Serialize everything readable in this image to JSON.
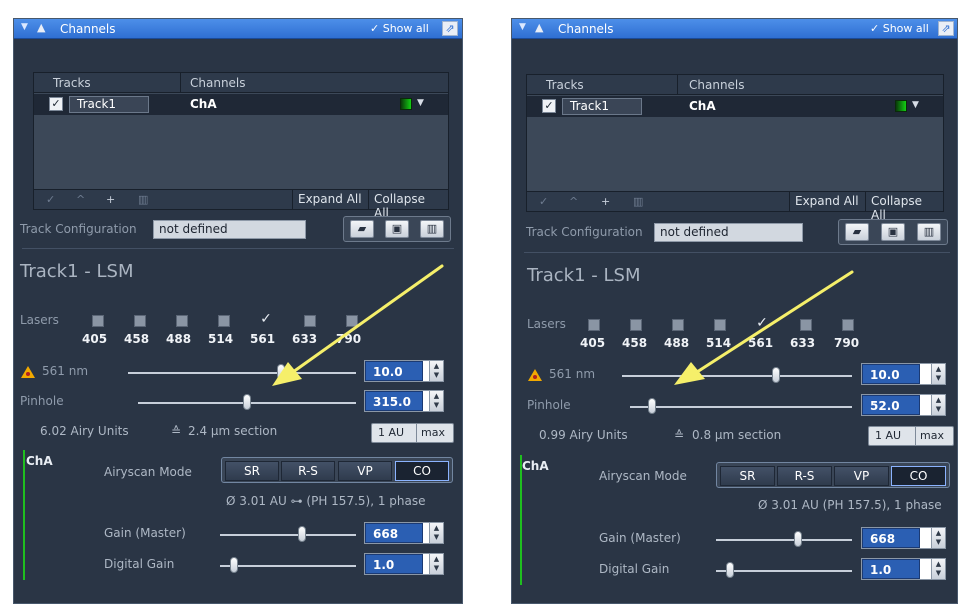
{
  "panels": [
    {
      "header": {
        "title": "Channels",
        "show_all": "✓ Show all",
        "popout_icon": "popout-icon"
      },
      "tracks_table": {
        "columns": [
          "Tracks",
          "Channels"
        ],
        "row": {
          "checked": true,
          "track": "Track1",
          "channel": "ChA",
          "color": "#13d013"
        },
        "footer_buttons": [
          "Expand All",
          "Collapse All"
        ]
      },
      "track_config": {
        "label": "Track Configuration",
        "value": "not defined"
      },
      "section_title": "Track1 - LSM",
      "lasers": {
        "label": "Lasers",
        "wavelengths": [
          "405",
          "458",
          "488",
          "514",
          "561",
          "633",
          "790"
        ],
        "checked": "561"
      },
      "laser_power": {
        "label": "561 nm",
        "value": "10.0",
        "level": 0.67
      },
      "pinhole": {
        "label": "Pinhole",
        "value": "315.0",
        "level": 0.5
      },
      "pinhole_info": {
        "airy": "6.02 Airy Units",
        "section": "2.4 µm section",
        "au_button": "1 AU",
        "max_button": "max"
      },
      "channel": {
        "name": "ChA",
        "color": "#1fbf1f"
      },
      "airyscan": {
        "label": "Airyscan Mode",
        "modes": [
          "SR",
          "R-S",
          "VP",
          "CO"
        ],
        "active": "CO"
      },
      "phase_info": "Ø 3.01 AU ⊶ (PH 157.5), 1 phase",
      "gain": {
        "label": "Gain (Master)",
        "value": "668",
        "level": 0.6
      },
      "digital_gain": {
        "label": "Digital Gain",
        "value": "1.0",
        "level": 0.1
      }
    },
    {
      "header": {
        "title": "Channels",
        "show_all": "✓ Show all",
        "popout_icon": "popout-icon"
      },
      "tracks_table": {
        "columns": [
          "Tracks",
          "Channels"
        ],
        "row": {
          "checked": true,
          "track": "Track1",
          "channel": "ChA",
          "color": "#13d013"
        },
        "footer_buttons": [
          "Expand All",
          "Collapse All"
        ]
      },
      "track_config": {
        "label": "Track Configuration",
        "value": "not defined"
      },
      "section_title": "Track1 - LSM",
      "lasers": {
        "label": "Lasers",
        "wavelengths": [
          "405",
          "458",
          "488",
          "514",
          "561",
          "633",
          "790"
        ],
        "checked": "561"
      },
      "laser_power": {
        "label": "561 nm",
        "value": "10.0",
        "level": 0.67
      },
      "pinhole": {
        "label": "Pinhole",
        "value": "52.0",
        "level": 0.1
      },
      "pinhole_info": {
        "airy": "0.99 Airy Units",
        "section": "0.8 µm section",
        "au_button": "1 AU",
        "max_button": "max"
      },
      "channel": {
        "name": "ChA",
        "color": "#1fbf1f"
      },
      "airyscan": {
        "label": "Airyscan Mode",
        "modes": [
          "SR",
          "R-S",
          "VP",
          "CO"
        ],
        "active": "CO"
      },
      "phase_info": "Ø 3.01 AU (PH 157.5), 1 phase",
      "gain": {
        "label": "Gain (Master)",
        "value": "668",
        "level": 0.6
      },
      "digital_gain": {
        "label": "Digital Gain",
        "value": "1.0",
        "level": 0.1
      }
    }
  ],
  "annotation_arrow_color": "#f5ef6a"
}
